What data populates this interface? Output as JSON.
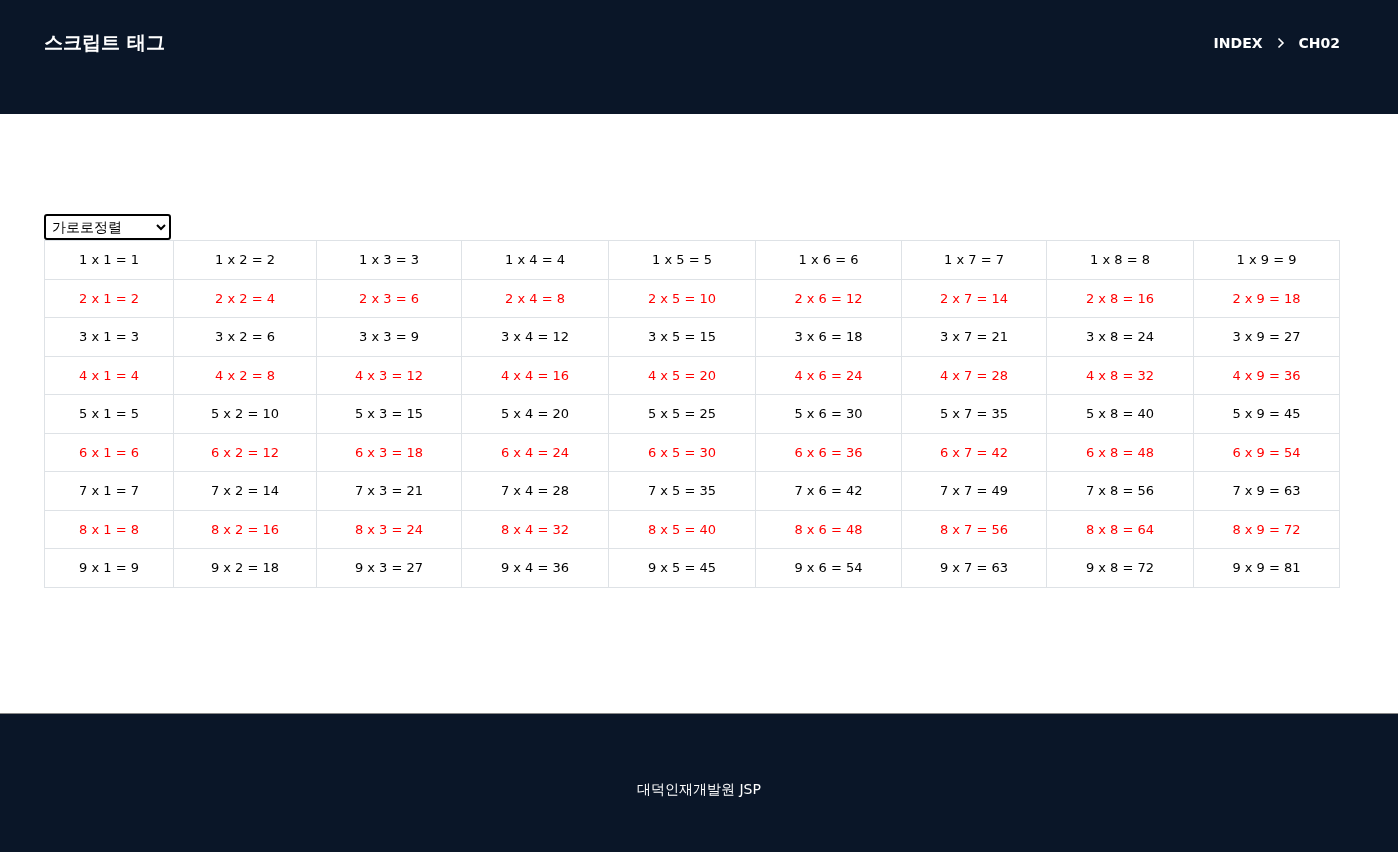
{
  "header": {
    "title": "스크립트 태그",
    "breadcrumb": [
      "INDEX",
      "CH02"
    ]
  },
  "select": {
    "value": "가로로정렬"
  },
  "table": {
    "rows": [
      {
        "color": "#000000",
        "cells": [
          "1 x 1 = 1",
          "1 x 2 = 2",
          "1 x 3 = 3",
          "1 x 4 = 4",
          "1 x 5 = 5",
          "1 x 6 = 6",
          "1 x 7 = 7",
          "1 x 8 = 8",
          "1 x 9 = 9"
        ]
      },
      {
        "color": "#ff0000",
        "cells": [
          "2 x 1 = 2",
          "2 x 2 = 4",
          "2 x 3 = 6",
          "2 x 4 = 8",
          "2 x 5 = 10",
          "2 x 6 = 12",
          "2 x 7 = 14",
          "2 x 8 = 16",
          "2 x 9 = 18"
        ]
      },
      {
        "color": "#000000",
        "cells": [
          "3 x 1 = 3",
          "3 x 2 = 6",
          "3 x 3 = 9",
          "3 x 4 = 12",
          "3 x 5 = 15",
          "3 x 6 = 18",
          "3 x 7 = 21",
          "3 x 8 = 24",
          "3 x 9 = 27"
        ]
      },
      {
        "color": "#ff0000",
        "cells": [
          "4 x 1 = 4",
          "4 x 2 = 8",
          "4 x 3 = 12",
          "4 x 4 = 16",
          "4 x 5 = 20",
          "4 x 6 = 24",
          "4 x 7 = 28",
          "4 x 8 = 32",
          "4 x 9 = 36"
        ]
      },
      {
        "color": "#000000",
        "cells": [
          "5 x 1 = 5",
          "5 x 2 = 10",
          "5 x 3 = 15",
          "5 x 4 = 20",
          "5 x 5 = 25",
          "5 x 6 = 30",
          "5 x 7 = 35",
          "5 x 8 = 40",
          "5 x 9 = 45"
        ]
      },
      {
        "color": "#ff0000",
        "cells": [
          "6 x 1 = 6",
          "6 x 2 = 12",
          "6 x 3 = 18",
          "6 x 4 = 24",
          "6 x 5 = 30",
          "6 x 6 = 36",
          "6 x 7 = 42",
          "6 x 8 = 48",
          "6 x 9 = 54"
        ]
      },
      {
        "color": "#000000",
        "cells": [
          "7 x 1 = 7",
          "7 x 2 = 14",
          "7 x 3 = 21",
          "7 x 4 = 28",
          "7 x 5 = 35",
          "7 x 6 = 42",
          "7 x 7 = 49",
          "7 x 8 = 56",
          "7 x 9 = 63"
        ]
      },
      {
        "color": "#ff0000",
        "cells": [
          "8 x 1 = 8",
          "8 x 2 = 16",
          "8 x 3 = 24",
          "8 x 4 = 32",
          "8 x 5 = 40",
          "8 x 6 = 48",
          "8 x 7 = 56",
          "8 x 8 = 64",
          "8 x 9 = 72"
        ]
      },
      {
        "color": "#000000",
        "cells": [
          "9 x 1 = 9",
          "9 x 2 = 18",
          "9 x 3 = 27",
          "9 x 4 = 36",
          "9 x 5 = 45",
          "9 x 6 = 54",
          "9 x 7 = 63",
          "9 x 8 = 72",
          "9 x 9 = 81"
        ]
      }
    ]
  },
  "footer": {
    "text": "대덕인재개발원 JSP"
  }
}
